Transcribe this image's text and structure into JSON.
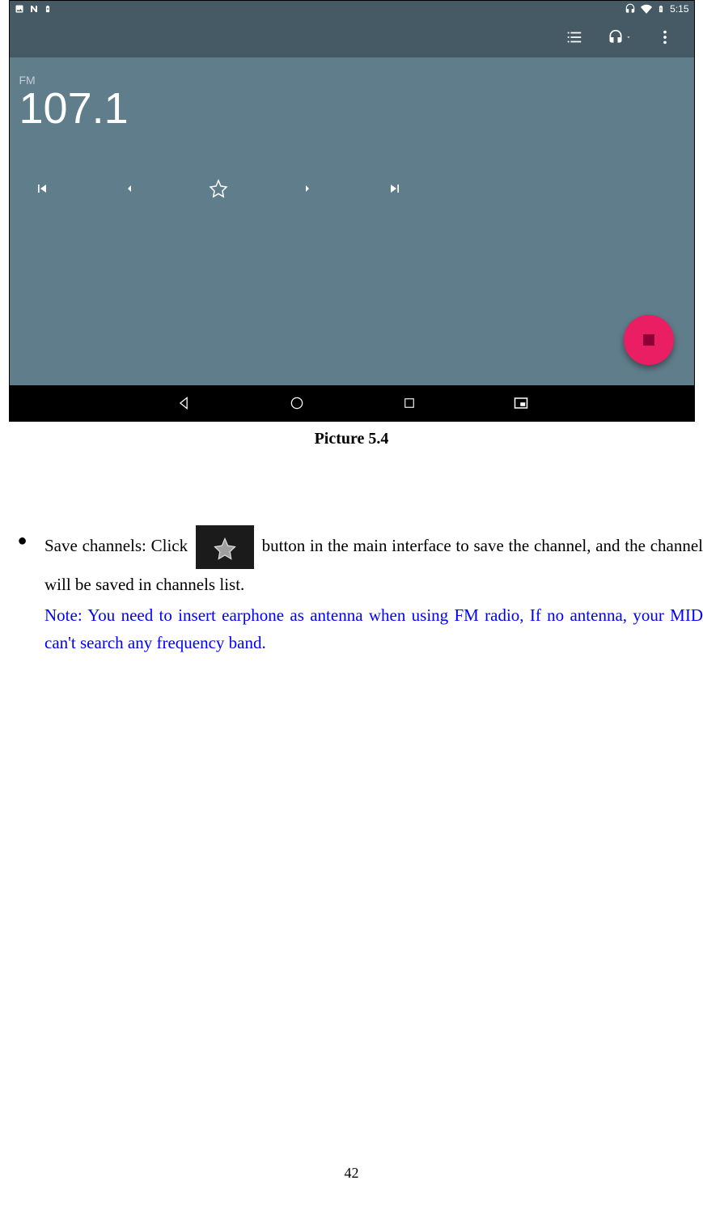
{
  "statusbar": {
    "time": "5:15"
  },
  "radio": {
    "band_label": "FM",
    "frequency": "107.1"
  },
  "caption": "Picture 5.4",
  "bullet": {
    "text_before": "Save channels: Click ",
    "text_after": " button in the main interface to save the channel, and the channel will be saved in channels list."
  },
  "note_text": "Note: You need to insert earphone as antenna when using FM radio, If no antenna, your MID can't search any frequency band.",
  "page_number": "42"
}
